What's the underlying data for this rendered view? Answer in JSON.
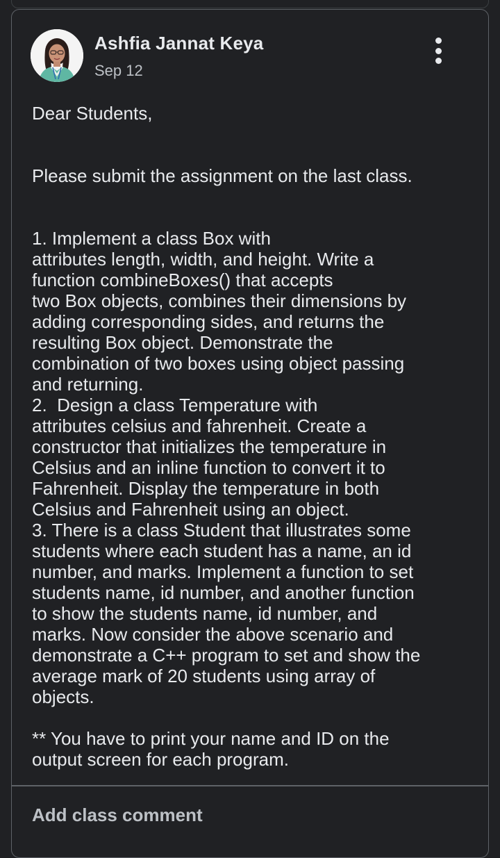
{
  "post": {
    "author": "Ashfia Jannat Keya",
    "date": "Sep 12",
    "greeting": "Dear Students,",
    "instruction": "Please submit the assignment on the last class.",
    "body": "1. Implement a class Box with\nattributes length, width, and height. Write a\nfunction combineBoxes() that accepts\ntwo Box objects, combines their dimensions by\nadding corresponding sides, and returns the\nresulting Box object. Demonstrate the\ncombination of two boxes using object passing\nand returning.\n2.  Design a class Temperature with\nattributes celsius and fahrenheit. Create a\nconstructor that initializes the temperature in\nCelsius and an inline function to convert it to\nFahrenheit. Display the temperature in both\nCelsius and Fahrenheit using an object.\n3. There is a class Student that illustrates some\nstudents where each student has a name, an id\nnumber, and marks. Implement a function to set\nstudents name, id number, and another function\nto show the students name, id number, and\nmarks. Now consider the above scenario and\ndemonstrate a C++ program to set and show the\naverage mark of 20 students using array of\nobjects.",
    "note": "** You have to print your name and ID on the\noutput screen for each program."
  },
  "comment": {
    "label": "Add class comment"
  },
  "icons": {
    "more": "more-vert-icon",
    "avatar": "avatar"
  },
  "colors": {
    "background": "#202124",
    "border": "#5f6368",
    "text": "#e8eaed",
    "secondary_text": "#bdc1c6"
  }
}
